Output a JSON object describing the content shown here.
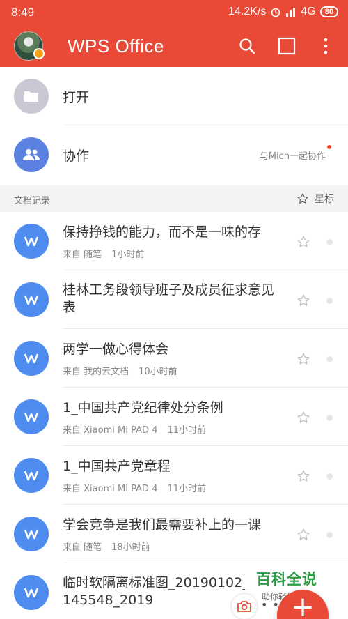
{
  "status_bar": {
    "time": "8:49",
    "speed": "14.2K/s",
    "network": "4G",
    "battery": "80"
  },
  "app_bar": {
    "title": "WPS Office",
    "color": "#e94a37"
  },
  "actions": {
    "open_label": "打开",
    "collab_label": "协作",
    "collab_hint": "与Mich一起协作"
  },
  "section": {
    "title": "文档记录",
    "star_label": "星标"
  },
  "documents": [
    {
      "title": "保持挣钱的能力，而不是一味的存",
      "source": "来自  随笔",
      "time": "1小时前"
    },
    {
      "title": "桂林工务段领导班子及成员征求意见表",
      "source": "",
      "time": ""
    },
    {
      "title": "两学一做心得体会",
      "source": "来自  我的云文档",
      "time": "10小时前"
    },
    {
      "title": "1_中国共产党纪律处分条例",
      "source": "来自  Xiaomi MI PAD 4",
      "time": "11小时前"
    },
    {
      "title": "1_中国共产党章程",
      "source": "来自  Xiaomi MI PAD 4",
      "time": "11小时前"
    },
    {
      "title": "学会竞争是我们最需要补上的一课",
      "source": "来自  随笔",
      "time": "18小时前"
    },
    {
      "title": "临时软隔离标准图_20190102_145548_2019",
      "source": "",
      "time": ""
    }
  ],
  "watermark": {
    "title": "百科全说",
    "subtitle": "助你轻松解决"
  },
  "fab_label": "+"
}
